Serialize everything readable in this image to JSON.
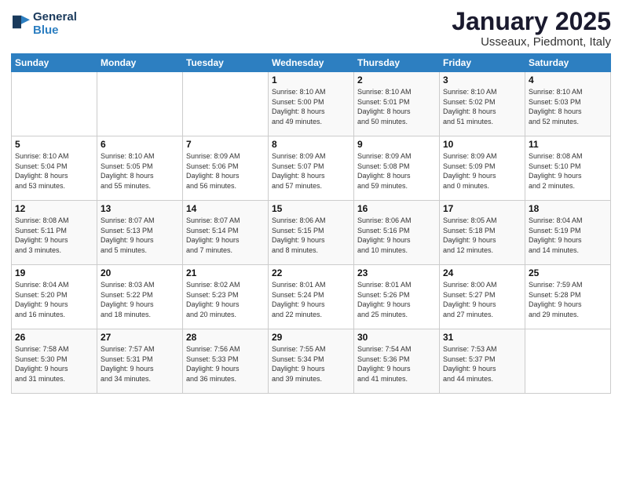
{
  "header": {
    "logo_line1": "General",
    "logo_line2": "Blue",
    "title": "January 2025",
    "subtitle": "Usseaux, Piedmont, Italy"
  },
  "weekdays": [
    "Sunday",
    "Monday",
    "Tuesday",
    "Wednesday",
    "Thursday",
    "Friday",
    "Saturday"
  ],
  "weeks": [
    [
      {
        "day": "",
        "info": ""
      },
      {
        "day": "",
        "info": ""
      },
      {
        "day": "",
        "info": ""
      },
      {
        "day": "1",
        "info": "Sunrise: 8:10 AM\nSunset: 5:00 PM\nDaylight: 8 hours\nand 49 minutes."
      },
      {
        "day": "2",
        "info": "Sunrise: 8:10 AM\nSunset: 5:01 PM\nDaylight: 8 hours\nand 50 minutes."
      },
      {
        "day": "3",
        "info": "Sunrise: 8:10 AM\nSunset: 5:02 PM\nDaylight: 8 hours\nand 51 minutes."
      },
      {
        "day": "4",
        "info": "Sunrise: 8:10 AM\nSunset: 5:03 PM\nDaylight: 8 hours\nand 52 minutes."
      }
    ],
    [
      {
        "day": "5",
        "info": "Sunrise: 8:10 AM\nSunset: 5:04 PM\nDaylight: 8 hours\nand 53 minutes."
      },
      {
        "day": "6",
        "info": "Sunrise: 8:10 AM\nSunset: 5:05 PM\nDaylight: 8 hours\nand 55 minutes."
      },
      {
        "day": "7",
        "info": "Sunrise: 8:09 AM\nSunset: 5:06 PM\nDaylight: 8 hours\nand 56 minutes."
      },
      {
        "day": "8",
        "info": "Sunrise: 8:09 AM\nSunset: 5:07 PM\nDaylight: 8 hours\nand 57 minutes."
      },
      {
        "day": "9",
        "info": "Sunrise: 8:09 AM\nSunset: 5:08 PM\nDaylight: 8 hours\nand 59 minutes."
      },
      {
        "day": "10",
        "info": "Sunrise: 8:09 AM\nSunset: 5:09 PM\nDaylight: 9 hours\nand 0 minutes."
      },
      {
        "day": "11",
        "info": "Sunrise: 8:08 AM\nSunset: 5:10 PM\nDaylight: 9 hours\nand 2 minutes."
      }
    ],
    [
      {
        "day": "12",
        "info": "Sunrise: 8:08 AM\nSunset: 5:11 PM\nDaylight: 9 hours\nand 3 minutes."
      },
      {
        "day": "13",
        "info": "Sunrise: 8:07 AM\nSunset: 5:13 PM\nDaylight: 9 hours\nand 5 minutes."
      },
      {
        "day": "14",
        "info": "Sunrise: 8:07 AM\nSunset: 5:14 PM\nDaylight: 9 hours\nand 7 minutes."
      },
      {
        "day": "15",
        "info": "Sunrise: 8:06 AM\nSunset: 5:15 PM\nDaylight: 9 hours\nand 8 minutes."
      },
      {
        "day": "16",
        "info": "Sunrise: 8:06 AM\nSunset: 5:16 PM\nDaylight: 9 hours\nand 10 minutes."
      },
      {
        "day": "17",
        "info": "Sunrise: 8:05 AM\nSunset: 5:18 PM\nDaylight: 9 hours\nand 12 minutes."
      },
      {
        "day": "18",
        "info": "Sunrise: 8:04 AM\nSunset: 5:19 PM\nDaylight: 9 hours\nand 14 minutes."
      }
    ],
    [
      {
        "day": "19",
        "info": "Sunrise: 8:04 AM\nSunset: 5:20 PM\nDaylight: 9 hours\nand 16 minutes."
      },
      {
        "day": "20",
        "info": "Sunrise: 8:03 AM\nSunset: 5:22 PM\nDaylight: 9 hours\nand 18 minutes."
      },
      {
        "day": "21",
        "info": "Sunrise: 8:02 AM\nSunset: 5:23 PM\nDaylight: 9 hours\nand 20 minutes."
      },
      {
        "day": "22",
        "info": "Sunrise: 8:01 AM\nSunset: 5:24 PM\nDaylight: 9 hours\nand 22 minutes."
      },
      {
        "day": "23",
        "info": "Sunrise: 8:01 AM\nSunset: 5:26 PM\nDaylight: 9 hours\nand 25 minutes."
      },
      {
        "day": "24",
        "info": "Sunrise: 8:00 AM\nSunset: 5:27 PM\nDaylight: 9 hours\nand 27 minutes."
      },
      {
        "day": "25",
        "info": "Sunrise: 7:59 AM\nSunset: 5:28 PM\nDaylight: 9 hours\nand 29 minutes."
      }
    ],
    [
      {
        "day": "26",
        "info": "Sunrise: 7:58 AM\nSunset: 5:30 PM\nDaylight: 9 hours\nand 31 minutes."
      },
      {
        "day": "27",
        "info": "Sunrise: 7:57 AM\nSunset: 5:31 PM\nDaylight: 9 hours\nand 34 minutes."
      },
      {
        "day": "28",
        "info": "Sunrise: 7:56 AM\nSunset: 5:33 PM\nDaylight: 9 hours\nand 36 minutes."
      },
      {
        "day": "29",
        "info": "Sunrise: 7:55 AM\nSunset: 5:34 PM\nDaylight: 9 hours\nand 39 minutes."
      },
      {
        "day": "30",
        "info": "Sunrise: 7:54 AM\nSunset: 5:36 PM\nDaylight: 9 hours\nand 41 minutes."
      },
      {
        "day": "31",
        "info": "Sunrise: 7:53 AM\nSunset: 5:37 PM\nDaylight: 9 hours\nand 44 minutes."
      },
      {
        "day": "",
        "info": ""
      }
    ]
  ]
}
